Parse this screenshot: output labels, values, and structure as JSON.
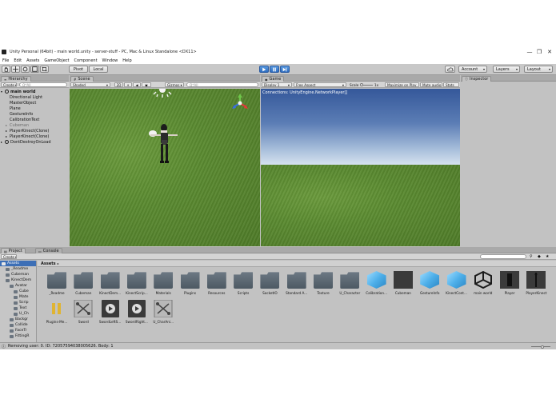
{
  "window": {
    "title": "Unity Personal (64bit) - main world.unity - server-stuff - PC, Mac & Linux Standalone <DX11>",
    "controls": [
      "—",
      "❐",
      "✕"
    ]
  },
  "menu": [
    "File",
    "Edit",
    "Assets",
    "GameObject",
    "Component",
    "Window",
    "Help"
  ],
  "toolbar": {
    "pivot_label": "Pivot",
    "local_label": "Local",
    "account_label": "Account",
    "layers_label": "Layers",
    "layout_label": "Layout"
  },
  "hierarchy": {
    "tab_label": "Hierarchy",
    "create_label": "Create",
    "search_placeholder": "Q*All",
    "scene_name": "main world",
    "items": [
      {
        "label": "Directional Light",
        "indent": 1,
        "color": "#111111"
      },
      {
        "label": "MasterObject",
        "indent": 1,
        "color": "#111111"
      },
      {
        "label": "Plane",
        "indent": 1,
        "color": "#111111"
      },
      {
        "label": "GestureInfo",
        "indent": 1,
        "color": "#111111"
      },
      {
        "label": "CalibrationText",
        "indent": 1,
        "color": "#111111"
      },
      {
        "label": "Cubeman",
        "indent": 1,
        "color": "#6d6d6d"
      },
      {
        "label": "PlayerKinect(Clone)",
        "indent": 1,
        "color": "#111111"
      },
      {
        "label": "PlayerKinect(Clone)",
        "indent": 1,
        "color": "#111111"
      }
    ],
    "dont_destroy": "DontDestroyOnLoad"
  },
  "scene": {
    "tab_label": "Scene",
    "shaded_label": "Shaded",
    "mode_2d": "2D",
    "gizmos_label": "Gizmos",
    "search_placeholder": "Q*All"
  },
  "game": {
    "tab_label": "Game",
    "display_label": "Display 1",
    "aspect_label": "Free Aspect",
    "scale_label": "Scale",
    "scale_value": "1x",
    "maximize_label": "Maximize on Play",
    "mute_label": "Mute audio",
    "stats_label": "Stats",
    "overlay_text": "Connections: UnityEngine.NetworkPlayer[]"
  },
  "inspector": {
    "tab_label": "Inspector"
  },
  "project": {
    "project_tab": "Project",
    "console_tab": "Console",
    "create_label": "Create",
    "breadcrumb": "Assets",
    "tree": [
      {
        "label": "Assets",
        "indent": 0,
        "selected": true
      },
      {
        "label": "_Readme",
        "indent": 1,
        "selected": false
      },
      {
        "label": "Cubeman",
        "indent": 1,
        "selected": false
      },
      {
        "label": "KinectDem",
        "indent": 1,
        "selected": false
      },
      {
        "label": "Avatar",
        "indent": 2,
        "selected": false
      },
      {
        "label": "Cube",
        "indent": 3,
        "selected": false
      },
      {
        "label": "Mate",
        "indent": 3,
        "selected": false
      },
      {
        "label": "Scrip",
        "indent": 3,
        "selected": false
      },
      {
        "label": "Text",
        "indent": 3,
        "selected": false
      },
      {
        "label": "U_Ch",
        "indent": 3,
        "selected": false
      },
      {
        "label": "Backgr",
        "indent": 2,
        "selected": false
      },
      {
        "label": "Collide",
        "indent": 2,
        "selected": false
      },
      {
        "label": "FaceTr",
        "indent": 2,
        "selected": false
      },
      {
        "label": "FittingR",
        "indent": 2,
        "selected": false
      }
    ],
    "assets_row1": [
      {
        "label": "_Readme",
        "kind": "folder"
      },
      {
        "label": "Cubeman",
        "kind": "folder"
      },
      {
        "label": "KinectDem...",
        "kind": "folder"
      },
      {
        "label": "KinectScrip...",
        "kind": "folder"
      },
      {
        "label": "Materials",
        "kind": "folder"
      },
      {
        "label": "Plugins",
        "kind": "folder"
      },
      {
        "label": "Resources",
        "kind": "folder"
      },
      {
        "label": "Scripts",
        "kind": "folder"
      },
      {
        "label": "SocketIO",
        "kind": "folder"
      },
      {
        "label": "Standard A...",
        "kind": "folder"
      },
      {
        "label": "Texture",
        "kind": "folder"
      },
      {
        "label": "U_Character",
        "kind": "folder"
      },
      {
        "label": "Calibration...",
        "kind": "cube"
      },
      {
        "label": "Cubeman",
        "kind": "dark"
      },
      {
        "label": "GestureInfo",
        "kind": "cube"
      },
      {
        "label": "KinectCont...",
        "kind": "cube"
      },
      {
        "label": "main world",
        "kind": "unity"
      },
      {
        "label": "Player",
        "kind": "player"
      },
      {
        "label": "PlayerKinect",
        "kind": "playerk"
      }
    ],
    "assets_row2": [
      {
        "label": "Plugins-Me...",
        "kind": "plugin"
      },
      {
        "label": "Sword",
        "kind": "prefab"
      },
      {
        "label": "SwordLeftS...",
        "kind": "audio"
      },
      {
        "label": "SwordRight...",
        "kind": "audio"
      },
      {
        "label": "U_CharAni...",
        "kind": "prefab"
      }
    ]
  },
  "status": {
    "message": "Removing user: 0. ID: 72057594038005626. Body: 1"
  },
  "colors": {
    "sky_top": "#3b5f9c",
    "sky_horizon": "#c9d8e8",
    "grass": "#5a8a30",
    "folder": "#5b6772",
    "play_active": "#3a78c8"
  }
}
